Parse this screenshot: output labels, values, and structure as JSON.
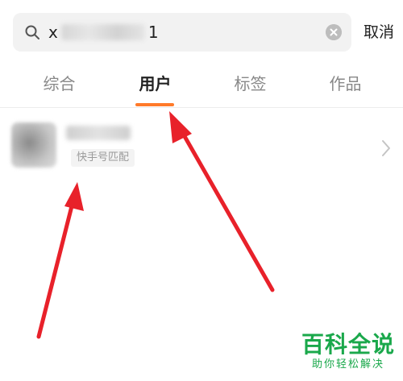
{
  "search": {
    "query_prefix": "x",
    "query_suffix": "1",
    "cancel_label": "取消"
  },
  "tabs": [
    {
      "label": "综合",
      "active": false
    },
    {
      "label": "用户",
      "active": true
    },
    {
      "label": "标签",
      "active": false
    },
    {
      "label": "作品",
      "active": false
    }
  ],
  "result": {
    "match_badge": "快手号匹配"
  },
  "watermark": {
    "title": "百科全说",
    "subtitle": "助你轻松解决"
  },
  "colors": {
    "accent": "#ff7a2a",
    "annotation_arrow": "#e8212a",
    "watermark": "#1aa84b"
  }
}
